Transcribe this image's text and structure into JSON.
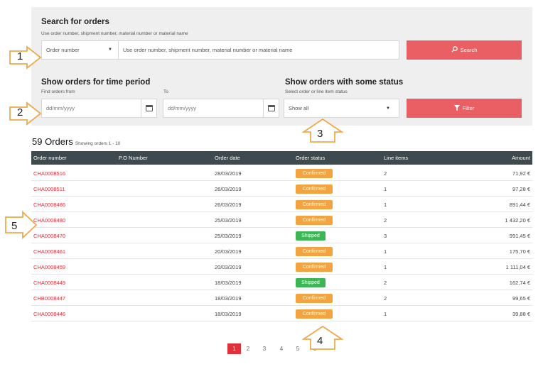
{
  "search": {
    "title": "Search for orders",
    "subtitle": "Use order number, shipment number, material number or material name",
    "type_selected": "Order number",
    "input_placeholder": "Use order number, shipment number, material number or material name",
    "button": "Search"
  },
  "period": {
    "title": "Show orders for time period",
    "from_label": "Find orders from",
    "to_label": "To",
    "from_placeholder": "dd/mm/yyyy",
    "to_placeholder": "dd/mm/yyyy"
  },
  "status_filter": {
    "title": "Show orders with some status",
    "subtitle": "Select order or line item status",
    "selected": "Show all",
    "button": "Filter"
  },
  "orders": {
    "count_label": "59 Orders",
    "showing": "Showing orders 1 - 10",
    "columns": [
      "Order number",
      "P.O Number",
      "Order date",
      "Order status",
      "Line items",
      "Amount"
    ],
    "rows": [
      {
        "number": "CHA0008516",
        "po": "",
        "date": "28/03/2019",
        "status": "Confirmed",
        "lines": "2",
        "amount": "71,92 €"
      },
      {
        "number": "CHA0008511",
        "po": "",
        "date": "26/03/2019",
        "status": "Confirmed",
        "lines": "1",
        "amount": "97,28 €"
      },
      {
        "number": "CHA0008486",
        "po": "",
        "date": "26/03/2019",
        "status": "Confirmed",
        "lines": "1",
        "amount": "891,44 €"
      },
      {
        "number": "CHA0008480",
        "po": "",
        "date": "25/03/2019",
        "status": "Confirmed",
        "lines": "2",
        "amount": "1 432,20 €"
      },
      {
        "number": "CHA0008470",
        "po": "",
        "date": "25/03/2019",
        "status": "Shipped",
        "lines": "3",
        "amount": "991,45 €"
      },
      {
        "number": "CHA0008461",
        "po": "",
        "date": "20/03/2019",
        "status": "Confirmed",
        "lines": "1",
        "amount": "175,70 €"
      },
      {
        "number": "CHA0008459",
        "po": "",
        "date": "20/03/2019",
        "status": "Confirmed",
        "lines": "1",
        "amount": "1 111,04 €"
      },
      {
        "number": "CHA0008449",
        "po": "",
        "date": "18/03/2019",
        "status": "Shipped",
        "lines": "2",
        "amount": "162,74 €"
      },
      {
        "number": "CHB0008447",
        "po": "",
        "date": "18/03/2019",
        "status": "Confirmed",
        "lines": "2",
        "amount": "99,65 €"
      },
      {
        "number": "CHA0008446",
        "po": "",
        "date": "18/03/2019",
        "status": "Confirmed",
        "lines": "1",
        "amount": "39,88 €"
      }
    ]
  },
  "pagination": {
    "pages": [
      "1",
      "2",
      "3",
      "4",
      "5",
      "6"
    ],
    "active": "1"
  },
  "annotations": [
    "1",
    "2",
    "3",
    "4",
    "5"
  ],
  "colors": {
    "accent_red": "#ea5f64",
    "link_red": "#e0303a",
    "confirmed": "#f4a341",
    "shipped": "#3cb554",
    "table_header": "#3e4a4e",
    "annotation_arrow": "#f0a94a"
  },
  "icons": {
    "search": "magnifier-icon",
    "filter": "funnel-icon",
    "calendar": "calendar-icon"
  }
}
